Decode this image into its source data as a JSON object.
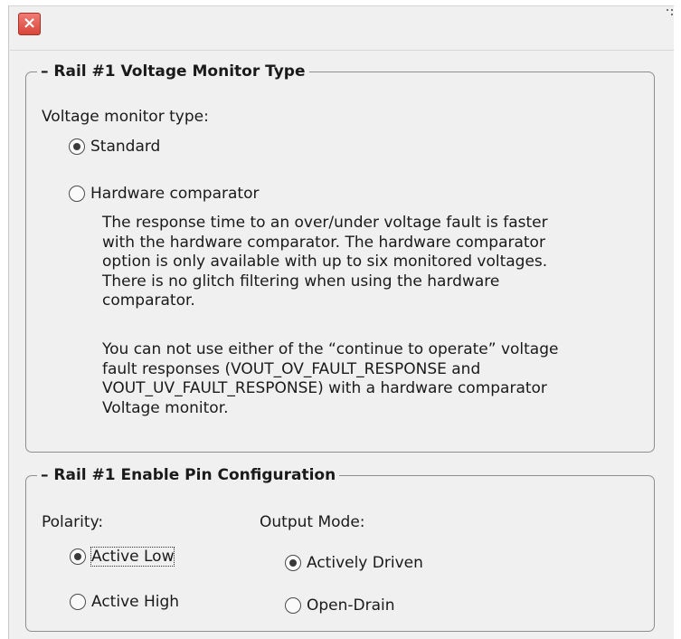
{
  "window": {
    "close_glyph": "×"
  },
  "voltage_group": {
    "title": "Rail #1 Voltage Monitor Type",
    "field_label": "Voltage monitor type:",
    "options": [
      {
        "label": "Standard",
        "checked": true
      },
      {
        "label": "Hardware comparator",
        "checked": false
      }
    ],
    "description_1": "The response time to an over/under voltage fault is faster\nwith the hardware comparator. The hardware comparator\noption is only available with up to six monitored voltages.\nThere is no glitch filtering when using the hardware\ncomparator.",
    "description_2": "You can not use either of the “continue to operate” voltage\nfault responses (VOUT_OV_FAULT_RESPONSE and\nVOUT_UV_FAULT_RESPONSE) with a hardware comparator\nVoltage monitor."
  },
  "enable_group": {
    "title": "Rail #1 Enable Pin Configuration",
    "polarity_label": "Polarity:",
    "polarity_options": [
      {
        "label": "Active Low",
        "checked": true
      },
      {
        "label": "Active High",
        "checked": false
      }
    ],
    "output_label": "Output Mode:",
    "output_options": [
      {
        "label": "Actively Driven",
        "checked": true
      },
      {
        "label": "Open-Drain",
        "checked": false
      }
    ]
  }
}
